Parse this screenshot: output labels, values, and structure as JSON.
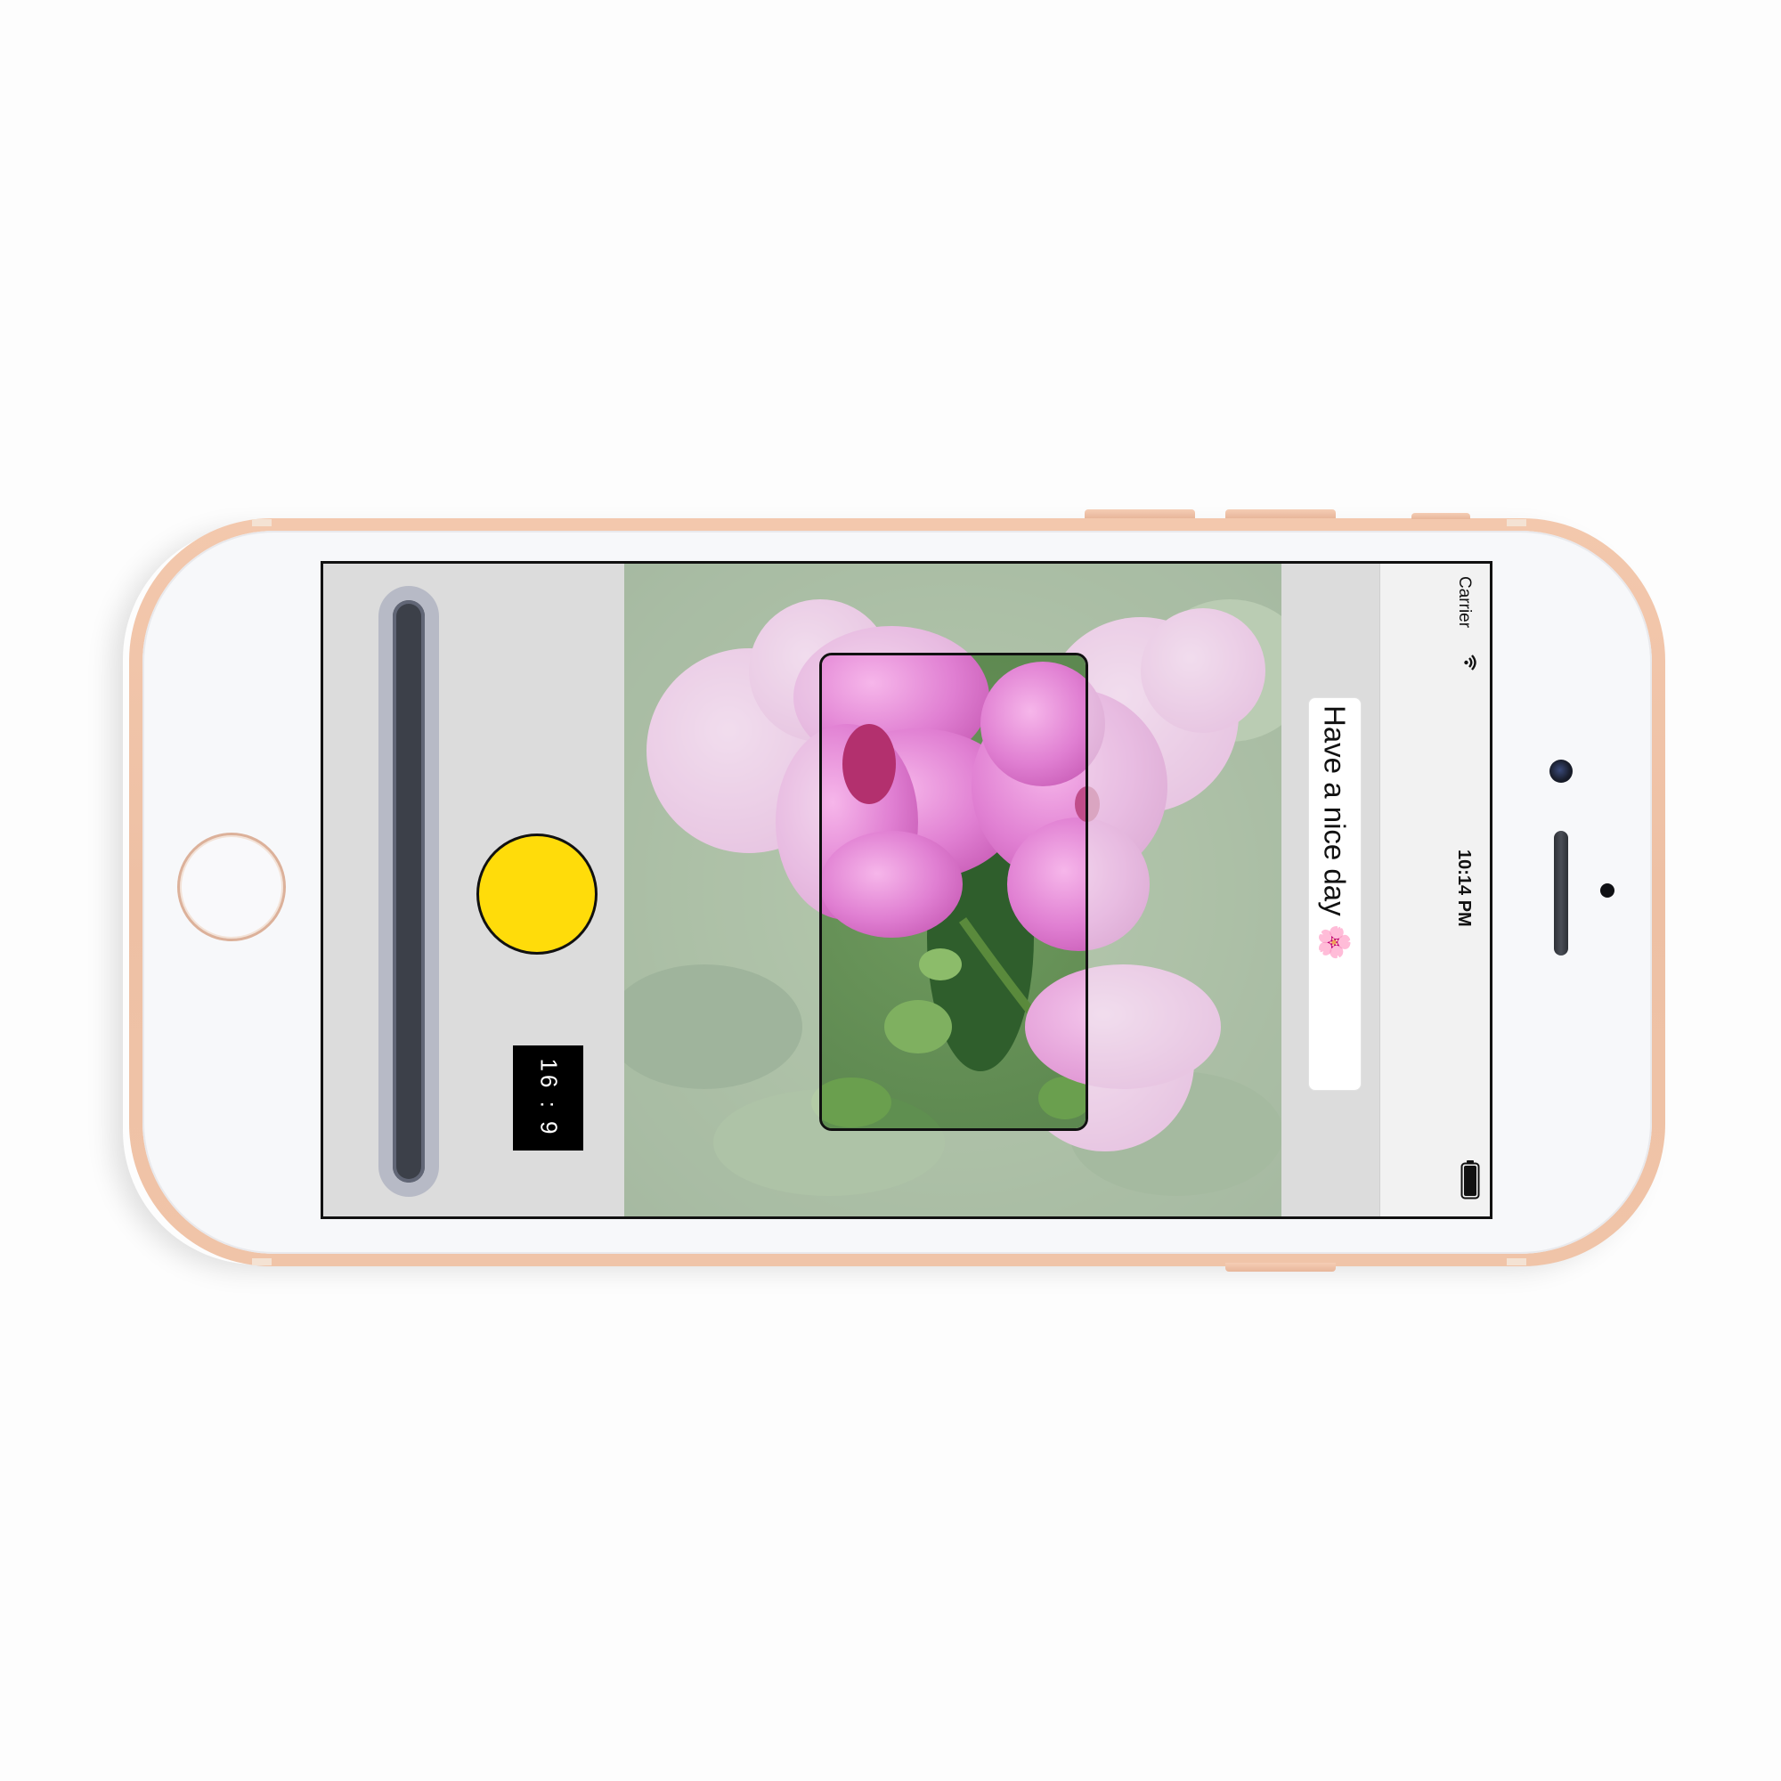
{
  "status_bar": {
    "carrier": "Carrier",
    "time": "10:14 PM",
    "wifi_icon": "wifi-icon",
    "battery_icon": "battery-icon"
  },
  "message": {
    "text": "Have a nice day 🌸"
  },
  "controls": {
    "aspect_ratio": "16 : 9",
    "shutter_icon": "shutter-button",
    "zoom_slider_icon": "zoom-slider"
  },
  "colors": {
    "shutter": "#ffdc0a",
    "phone_body": "#f0c4a8",
    "panel_background": "#dcdcdc"
  }
}
